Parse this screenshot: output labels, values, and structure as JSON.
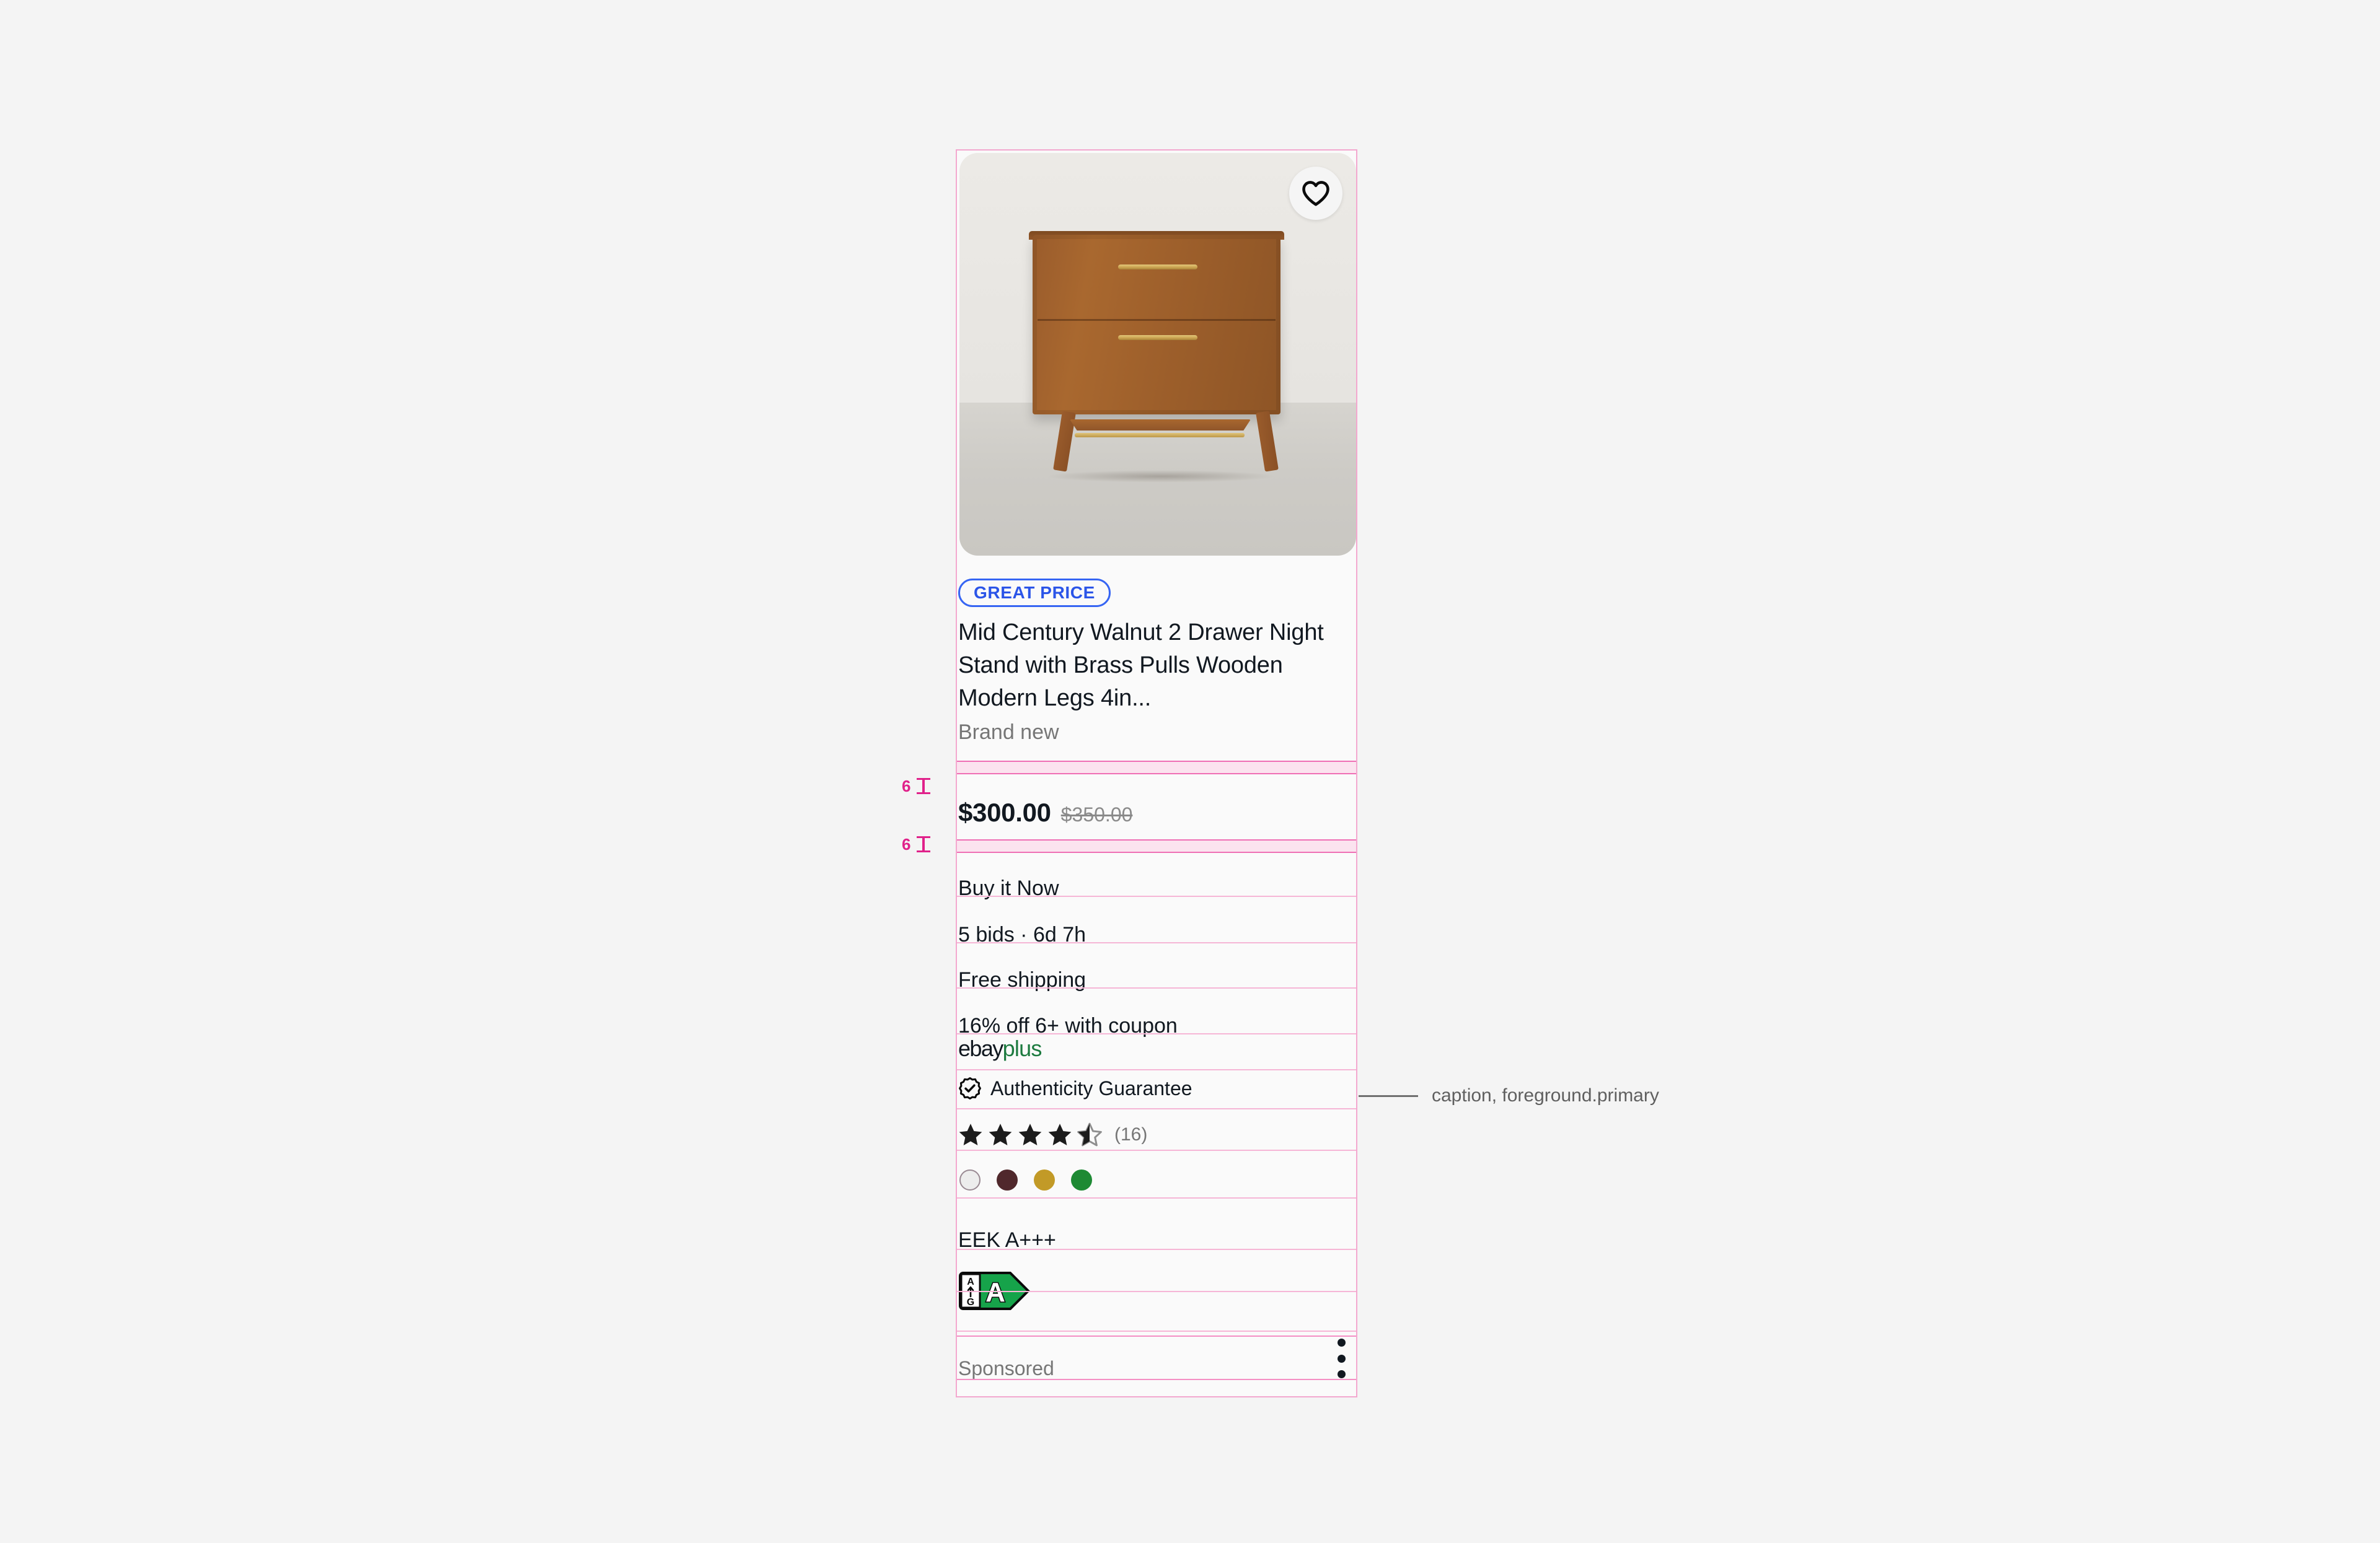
{
  "annotation": {
    "callout_label": "caption, foreground.primary",
    "spacing_marks": [
      {
        "value": "6"
      },
      {
        "value": "6"
      }
    ]
  },
  "card": {
    "image": {
      "alt_name": "mid-century walnut nightstand photo",
      "favorite_icon": "heart-icon"
    },
    "badge": {
      "label": "GREAT PRICE",
      "color": "#3665F3"
    },
    "title": "Mid Century Walnut 2 Drawer Night Stand with Brass Pulls Wooden Modern Legs 4in...",
    "condition": "Brand new",
    "price": {
      "current": "$300.00",
      "original": "$350.00"
    },
    "details": [
      "Buy it Now",
      "5 bids · 6d 7h",
      "Free shipping",
      "16% off 6+ with coupon"
    ],
    "ebay_plus": {
      "part1": "ebay",
      "part2": "plus",
      "plus_color": "#1C7A3F"
    },
    "authenticity": {
      "label": "Authenticity Guarantee",
      "icon": "verified-badge-icon"
    },
    "rating": {
      "stars": 4.5,
      "max": 5,
      "count": "(16)"
    },
    "swatches": [
      {
        "name": "white",
        "color": "#ededed",
        "border": "#9a8a93"
      },
      {
        "name": "dark-brown",
        "color": "#50282c"
      },
      {
        "name": "gold",
        "color": "#c29a27"
      },
      {
        "name": "green",
        "color": "#1e8a34"
      }
    ],
    "energy": {
      "label": "EEK A+++",
      "scale_top": "A",
      "scale_bottom": "G",
      "grade": "A",
      "grade_color": "#16a34a"
    },
    "footer": {
      "sponsored_label": "Sponsored",
      "menu_icon": "kebab-menu-icon"
    }
  }
}
